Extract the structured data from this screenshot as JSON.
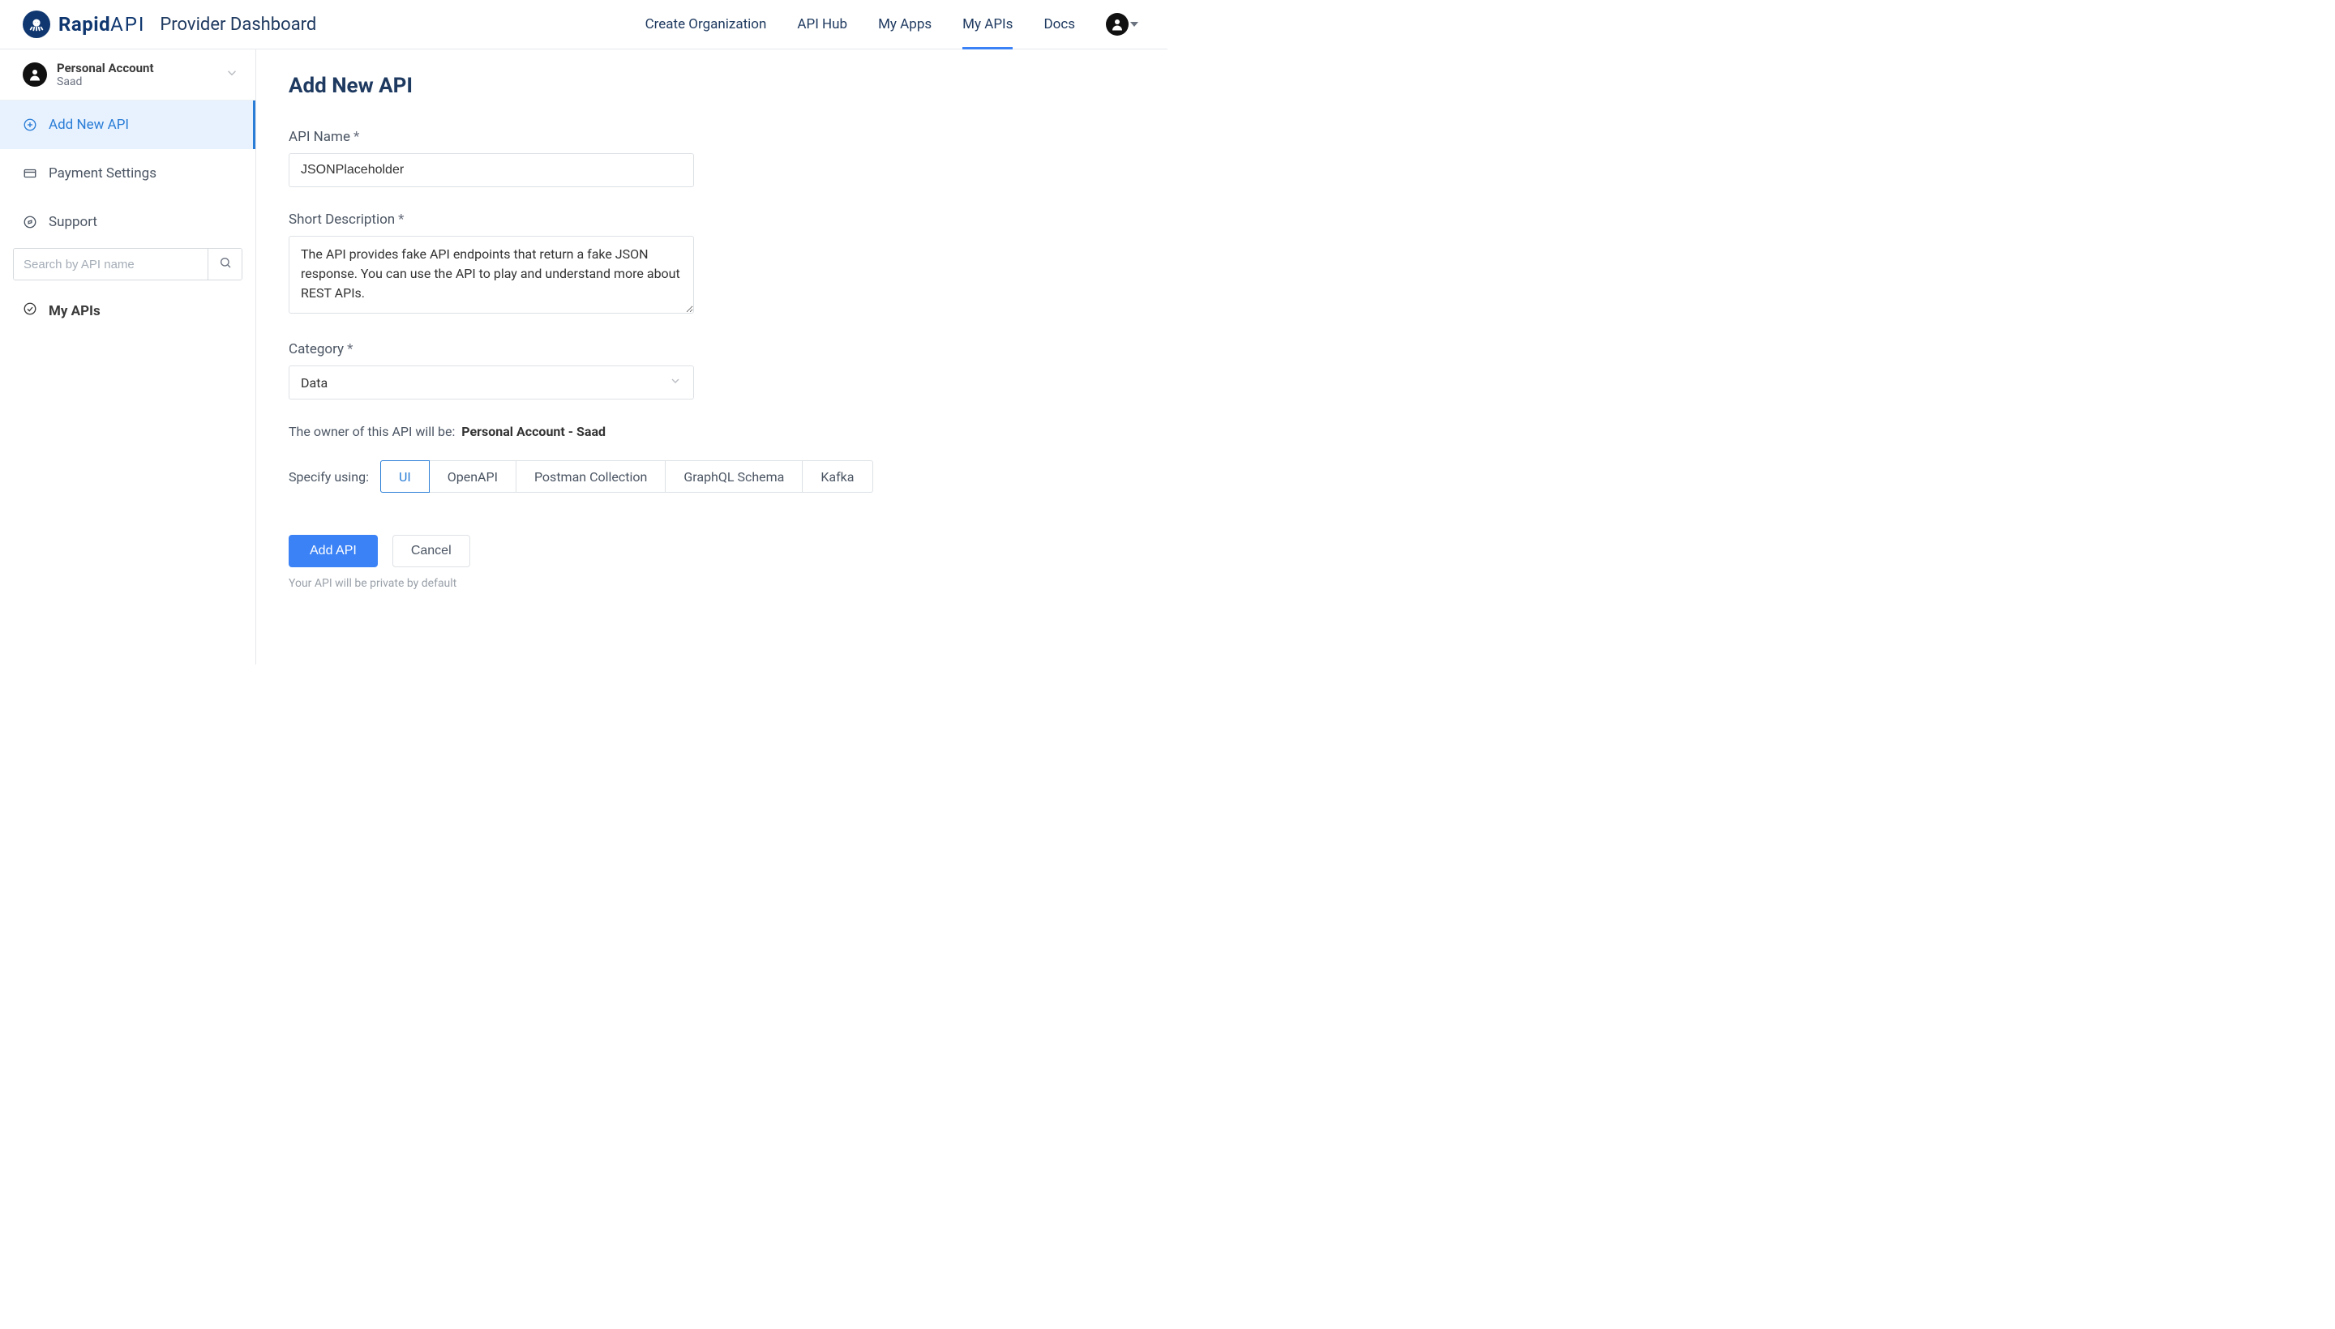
{
  "header": {
    "logo_text_bold": "Rapid",
    "logo_text_thin": "API",
    "dashboard_title": "Provider Dashboard",
    "nav": [
      {
        "label": "Create Organization",
        "active": false
      },
      {
        "label": "API Hub",
        "active": false
      },
      {
        "label": "My Apps",
        "active": false
      },
      {
        "label": "My APIs",
        "active": true
      },
      {
        "label": "Docs",
        "active": false
      }
    ]
  },
  "sidebar": {
    "account": {
      "title": "Personal Account",
      "subtitle": "Saad"
    },
    "items": [
      {
        "label": "Add New API"
      },
      {
        "label": "Payment Settings"
      },
      {
        "label": "Support"
      }
    ],
    "search_placeholder": "Search by API name",
    "heading": "My APIs"
  },
  "main": {
    "title": "Add New API",
    "api_name_label": "API Name",
    "api_name_value": "JSONPlaceholder",
    "short_desc_label": "Short Description",
    "short_desc_value": "The API provides fake API endpoints that return a fake JSON response. You can use the API to play and understand more about REST APIs.",
    "category_label": "Category",
    "category_value": "Data",
    "owner_prefix": "The owner of this API will be:",
    "owner_value": "Personal Account - Saad",
    "specify_label": "Specify using:",
    "specify_options": [
      "UI",
      "OpenAPI",
      "Postman Collection",
      "GraphQL Schema",
      "Kafka"
    ],
    "specify_selected": "UI",
    "primary_button": "Add API",
    "secondary_button": "Cancel",
    "hint": "Your API will be private by default"
  }
}
